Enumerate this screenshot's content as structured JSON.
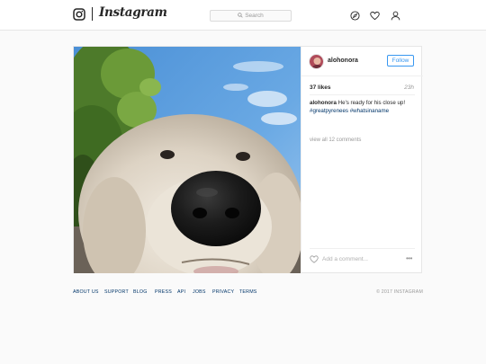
{
  "header": {
    "wordmark": "Instagram",
    "search_placeholder": "Search",
    "icons": [
      "instagram-logo-icon",
      "compass-icon",
      "heart-icon",
      "person-icon"
    ]
  },
  "post": {
    "username": "alohonora",
    "follow_label": "Follow",
    "likes": "37 likes",
    "time": "23h",
    "caption_user": "alohonora",
    "caption_text": "He's ready for his close up!",
    "hashtags": "#greatpyrenees #whatsinaname",
    "view_all": "view all 12 comments",
    "add_comment_placeholder": "Add a comment...",
    "more_label": "•••"
  },
  "footer": {
    "links": [
      "ABOUT US",
      "SUPPORT",
      "BLOG",
      "PRESS",
      "API",
      "JOBS",
      "PRIVACY",
      "TERMS"
    ],
    "copyright": "© 2017 INSTAGRAM"
  },
  "colors": {
    "accent": "#3897f0",
    "link": "#003569",
    "background": "#fafafa"
  }
}
